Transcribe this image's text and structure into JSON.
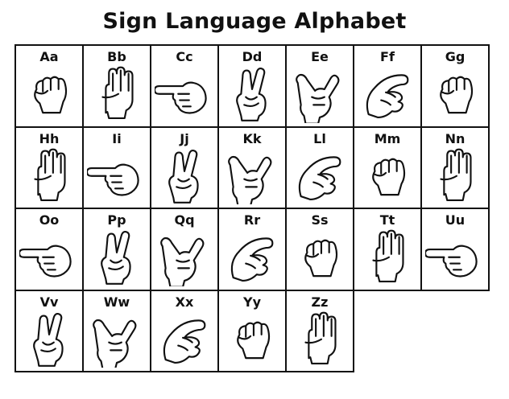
{
  "title": "Sign Language Alphabet",
  "letters": [
    {
      "label": "Aa",
      "icon": "fist-thumb-side-icon"
    },
    {
      "label": "Bb",
      "icon": "flat-hand-thumb-across-icon"
    },
    {
      "label": "Cc",
      "icon": "curved-c-hand-icon"
    },
    {
      "label": "Dd",
      "icon": "index-up-circle-icon"
    },
    {
      "label": "Ee",
      "icon": "curled-fingers-icon"
    },
    {
      "label": "Ff",
      "icon": "ok-three-fingers-icon"
    },
    {
      "label": "Gg",
      "icon": "index-pointing-side-icon"
    },
    {
      "label": "Hh",
      "icon": "two-fingers-side-icon"
    },
    {
      "label": "Ii",
      "icon": "pinky-up-icon"
    },
    {
      "label": "Jj",
      "icon": "pinky-j-motion-icon"
    },
    {
      "label": "Kk",
      "icon": "two-fingers-up-thumb-between-icon"
    },
    {
      "label": "Ll",
      "icon": "l-shape-hand-icon"
    },
    {
      "label": "Mm",
      "icon": "thumb-under-three-icon"
    },
    {
      "label": "Nn",
      "icon": "thumb-under-two-icon"
    },
    {
      "label": "Oo",
      "icon": "o-shape-hand-icon"
    },
    {
      "label": "Pp",
      "icon": "k-pointing-down-icon"
    },
    {
      "label": "Qq",
      "icon": "g-pointing-down-icon"
    },
    {
      "label": "Rr",
      "icon": "crossed-fingers-icon"
    },
    {
      "label": "Ss",
      "icon": "fist-thumb-front-icon"
    },
    {
      "label": "Tt",
      "icon": "thumb-between-fingers-icon"
    },
    {
      "label": "Uu",
      "icon": "two-fingers-together-up-icon"
    },
    {
      "label": "Vv",
      "icon": "v-peace-hand-icon"
    },
    {
      "label": "Ww",
      "icon": "three-fingers-up-icon"
    },
    {
      "label": "Xx",
      "icon": "hooked-index-icon"
    },
    {
      "label": "Yy",
      "icon": "thumb-pinky-out-icon"
    },
    {
      "label": "Zz",
      "icon": "index-z-motion-icon"
    }
  ]
}
